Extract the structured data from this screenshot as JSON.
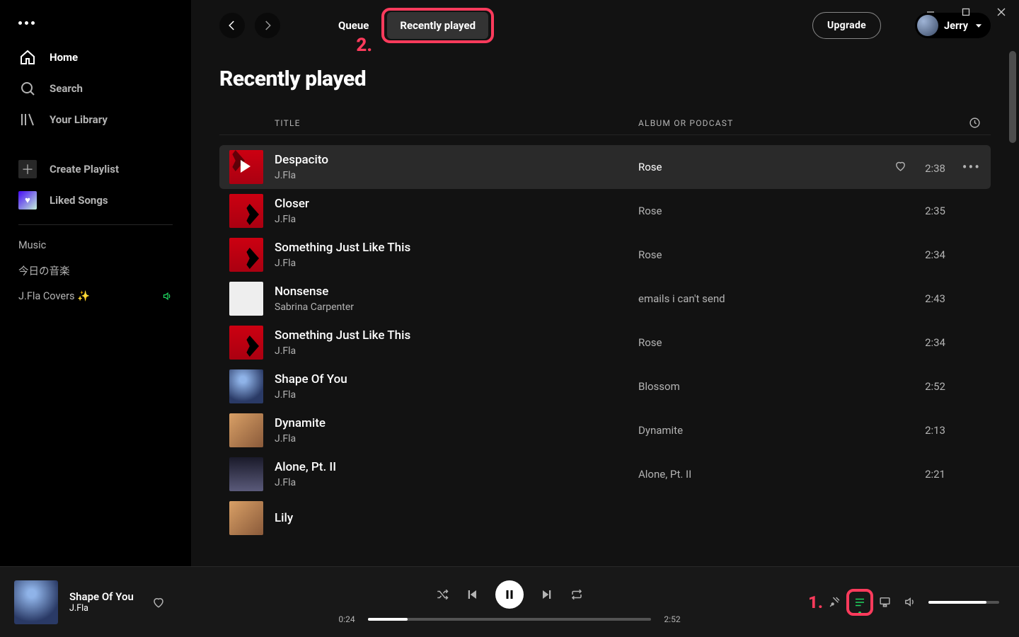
{
  "sidebar": {
    "nav": [
      {
        "label": "Home"
      },
      {
        "label": "Search"
      },
      {
        "label": "Your Library"
      }
    ],
    "actions": [
      {
        "label": "Create Playlist"
      },
      {
        "label": "Liked Songs"
      }
    ],
    "playlists": [
      {
        "label": "Music",
        "playing": false
      },
      {
        "label": "今日の音楽",
        "playing": false
      },
      {
        "label": "J.Fla Covers ✨",
        "playing": true
      }
    ]
  },
  "topbar": {
    "tabs": {
      "queue": "Queue",
      "recent": "Recently played"
    },
    "upgrade": "Upgrade",
    "user": "Jerry"
  },
  "page": {
    "title": "Recently played",
    "columns": {
      "title": "TITLE",
      "album": "ALBUM OR PODCAST"
    }
  },
  "tracks": [
    {
      "title": "Despacito",
      "artist": "J.Fla",
      "album": "Rose",
      "duration": "2:38",
      "cover": "cov-red",
      "hovered": true
    },
    {
      "title": "Closer",
      "artist": "J.Fla",
      "album": "Rose",
      "duration": "2:35",
      "cover": "cov-red"
    },
    {
      "title": "Something Just Like This",
      "artist": "J.Fla",
      "album": "Rose",
      "duration": "2:34",
      "cover": "cov-red"
    },
    {
      "title": "Nonsense",
      "artist": "Sabrina Carpenter",
      "album": "emails i can't send",
      "duration": "2:43",
      "cover": "cov-pale"
    },
    {
      "title": "Something Just Like This",
      "artist": "J.Fla",
      "album": "Rose",
      "duration": "2:34",
      "cover": "cov-red"
    },
    {
      "title": "Shape Of You",
      "artist": "J.Fla",
      "album": "Blossom",
      "duration": "2:52",
      "cover": "cov-blue"
    },
    {
      "title": "Dynamite",
      "artist": "J.Fla",
      "album": "Dynamite",
      "duration": "2:13",
      "cover": "cov-dyn"
    },
    {
      "title": "Alone, Pt. II",
      "artist": "J.Fla",
      "album": "Alone, Pt. II",
      "duration": "2:21",
      "cover": "cov-alone"
    },
    {
      "title": "Lily",
      "artist": "",
      "album": "",
      "duration": "",
      "cover": "cov-dyn"
    }
  ],
  "player": {
    "now": {
      "title": "Shape Of You",
      "artist": "J.Fla"
    },
    "elapsed": "0:24",
    "total": "2:52",
    "progress_pct": 14
  },
  "annotations": {
    "one": "1.",
    "two": "2."
  }
}
